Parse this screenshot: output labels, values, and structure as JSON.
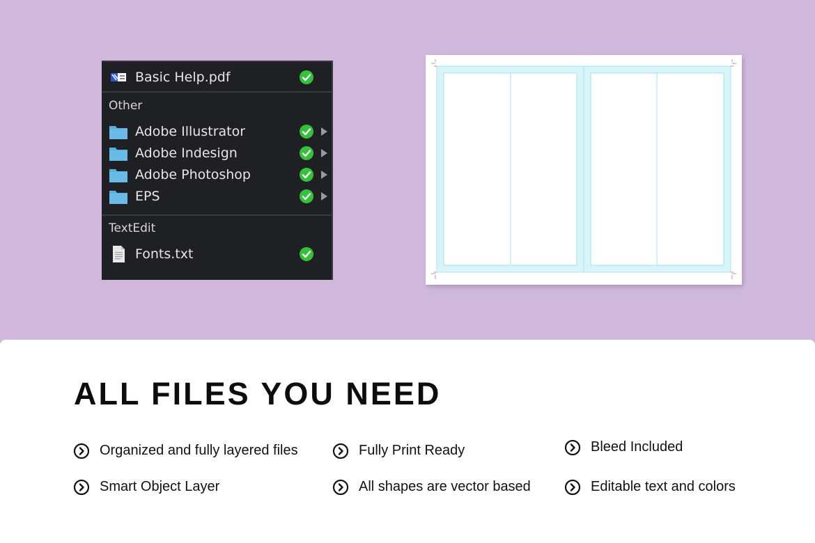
{
  "finder": {
    "top_file": {
      "name": "Basic Help.pdf",
      "icon": "pdf-file-icon",
      "status": "synced"
    },
    "groups": [
      {
        "header": "Other",
        "items": [
          {
            "name": "Adobe Illustrator",
            "icon": "folder-icon",
            "status": "synced",
            "expandable": true
          },
          {
            "name": "Adobe Indesign",
            "icon": "folder-icon",
            "status": "synced",
            "expandable": true
          },
          {
            "name": "Adobe Photoshop",
            "icon": "folder-icon",
            "status": "synced",
            "expandable": true
          },
          {
            "name": "EPS",
            "icon": "folder-icon",
            "status": "synced",
            "expandable": true
          }
        ]
      },
      {
        "header": "TextEdit",
        "items": [
          {
            "name": "Fonts.txt",
            "icon": "text-file-icon",
            "status": "synced",
            "expandable": false
          }
        ]
      }
    ]
  },
  "layout_preview": {
    "pages": 2,
    "columns_per_page": 2,
    "guide_color": "#9fe3ee",
    "bleed_color": "#d9f4f8"
  },
  "section": {
    "title": "ALL FILES YOU NEED",
    "features": [
      "Organized and fully layered files",
      "Fully Print Ready",
      "Bleed Included",
      "Smart Object Layer",
      "All shapes are vector based",
      "Editable text and colors"
    ],
    "feature_icon": "chevron-circle-icon"
  },
  "colors": {
    "background": "#cfb8dc",
    "panel": "#1f2023",
    "check": "#34c13c",
    "folder": "#5aaee0"
  }
}
